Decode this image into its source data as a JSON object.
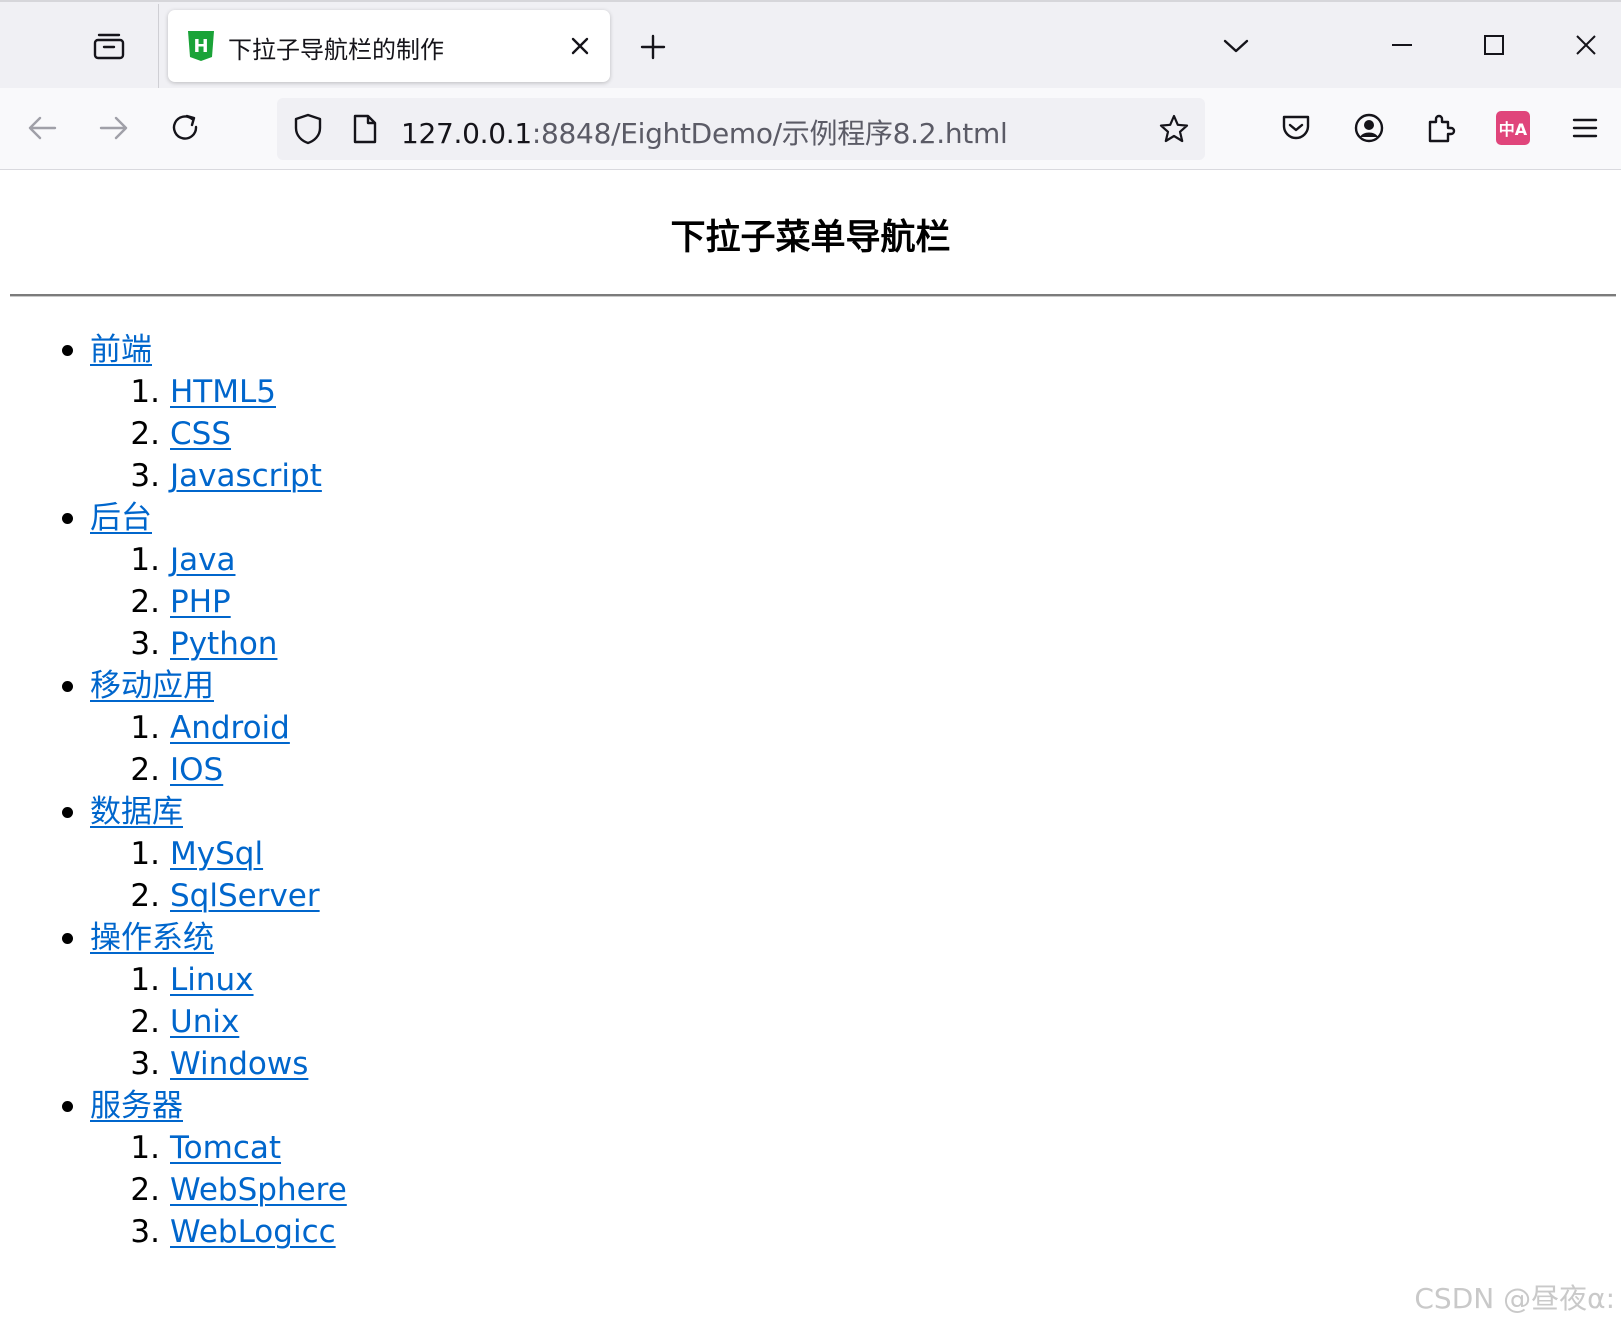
{
  "browser": {
    "tab": {
      "favicon_letter": "H",
      "title": "下拉子导航栏的制作"
    },
    "url": {
      "host": "127.0.0.1",
      "rest": ":8848/EightDemo/示例程序8.2.html"
    },
    "translate_badge": "中A"
  },
  "colors": {
    "link": "#0066cc",
    "favicon": "#1aa338",
    "translate_badge": "#e0457b"
  },
  "page": {
    "heading": "下拉子菜单导航栏",
    "menu": [
      {
        "label": "前端",
        "items": [
          {
            "num": "1.",
            "label": "HTML5"
          },
          {
            "num": "2.",
            "label": "CSS"
          },
          {
            "num": "3.",
            "label": "Javascript"
          }
        ]
      },
      {
        "label": "后台",
        "items": [
          {
            "num": "1.",
            "label": "Java"
          },
          {
            "num": "2.",
            "label": "PHP"
          },
          {
            "num": "3.",
            "label": "Python"
          }
        ]
      },
      {
        "label": "移动应用",
        "items": [
          {
            "num": "1.",
            "label": "Android"
          },
          {
            "num": "2.",
            "label": "IOS"
          }
        ]
      },
      {
        "label": "数据库",
        "items": [
          {
            "num": "1.",
            "label": "MySql"
          },
          {
            "num": "2.",
            "label": "SqlServer"
          }
        ]
      },
      {
        "label": "操作系统",
        "items": [
          {
            "num": "1.",
            "label": "Linux"
          },
          {
            "num": "2.",
            "label": "Unix"
          },
          {
            "num": "3.",
            "label": "Windows"
          }
        ]
      },
      {
        "label": "服务器",
        "items": [
          {
            "num": "1.",
            "label": "Tomcat"
          },
          {
            "num": "2.",
            "label": "WebSphere"
          },
          {
            "num": "3.",
            "label": "WebLogicc"
          }
        ]
      }
    ]
  },
  "watermark": "CSDN @昼夜α:"
}
